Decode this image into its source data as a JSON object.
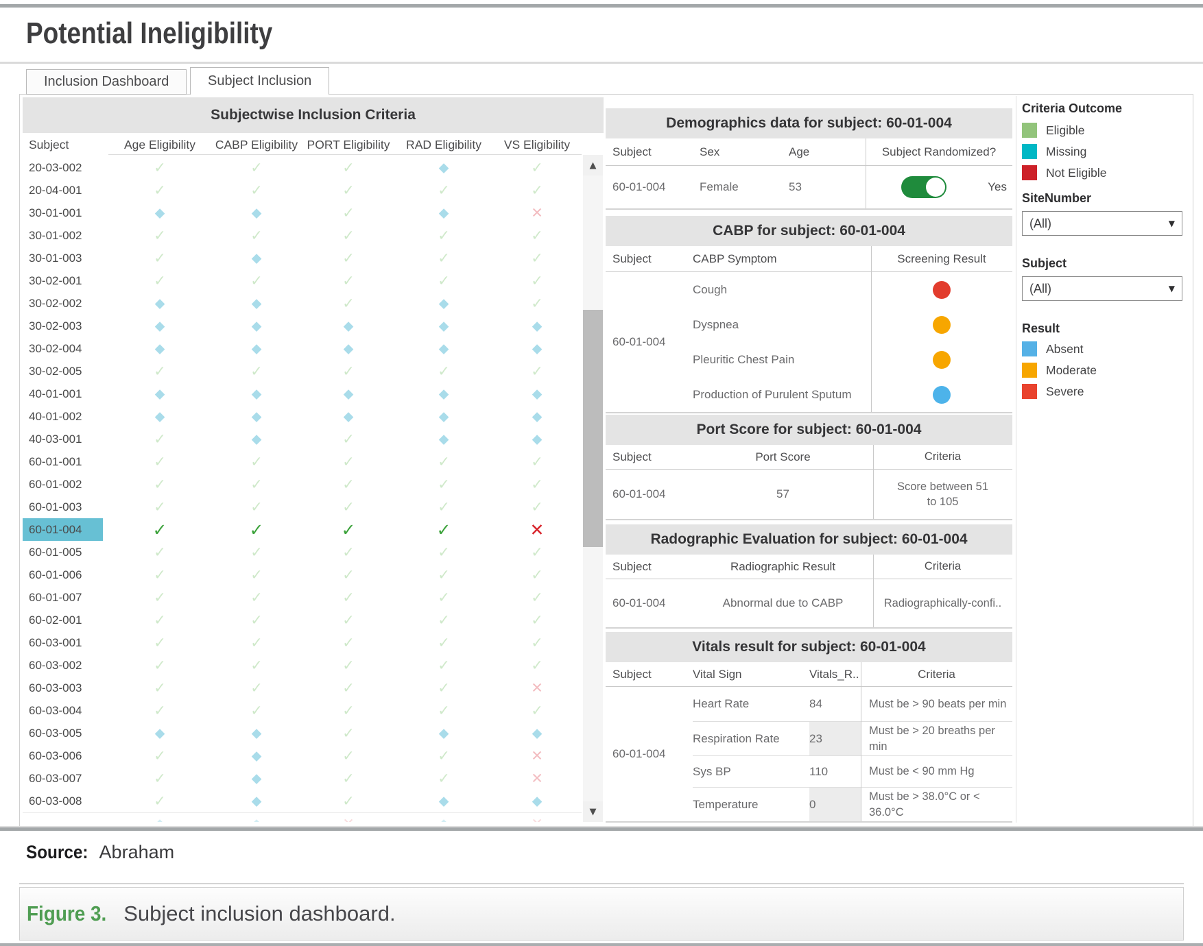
{
  "title": "Potential Ineligibility",
  "tabs": [
    {
      "label": "Inclusion Dashboard",
      "active": false
    },
    {
      "label": "Subject Inclusion",
      "active": true
    }
  ],
  "icons": {
    "scroll_up": "▲",
    "scroll_down": "▼",
    "dropdown_arrow": "▼"
  },
  "inclusion_table": {
    "title": "Subjectwise Inclusion Criteria",
    "columns": [
      "Subject",
      "Age Eligibility",
      "CABP Eligibility",
      "PORT Eligibility",
      "RAD Eligibility",
      "VS Eligibility"
    ],
    "rows": [
      {
        "subject": "20-03-002",
        "selected": false,
        "cells": [
          "eligible",
          "eligible",
          "eligible",
          "missing",
          "eligible"
        ]
      },
      {
        "subject": "20-04-001",
        "selected": false,
        "cells": [
          "eligible",
          "eligible",
          "eligible",
          "eligible",
          "eligible"
        ]
      },
      {
        "subject": "30-01-001",
        "selected": false,
        "cells": [
          "missing",
          "missing",
          "eligible",
          "missing",
          "not_eligible"
        ]
      },
      {
        "subject": "30-01-002",
        "selected": false,
        "cells": [
          "eligible",
          "eligible",
          "eligible",
          "eligible",
          "eligible"
        ]
      },
      {
        "subject": "30-01-003",
        "selected": false,
        "cells": [
          "eligible",
          "missing",
          "eligible",
          "eligible",
          "eligible"
        ]
      },
      {
        "subject": "30-02-001",
        "selected": false,
        "cells": [
          "eligible",
          "eligible",
          "eligible",
          "eligible",
          "eligible"
        ]
      },
      {
        "subject": "30-02-002",
        "selected": false,
        "cells": [
          "missing",
          "missing",
          "eligible",
          "missing",
          "eligible"
        ]
      },
      {
        "subject": "30-02-003",
        "selected": false,
        "cells": [
          "missing",
          "missing",
          "missing",
          "missing",
          "missing"
        ]
      },
      {
        "subject": "30-02-004",
        "selected": false,
        "cells": [
          "missing",
          "missing",
          "missing",
          "missing",
          "missing"
        ]
      },
      {
        "subject": "30-02-005",
        "selected": false,
        "cells": [
          "eligible",
          "eligible",
          "eligible",
          "eligible",
          "eligible"
        ]
      },
      {
        "subject": "40-01-001",
        "selected": false,
        "cells": [
          "missing",
          "missing",
          "missing",
          "missing",
          "missing"
        ]
      },
      {
        "subject": "40-01-002",
        "selected": false,
        "cells": [
          "missing",
          "missing",
          "missing",
          "missing",
          "missing"
        ]
      },
      {
        "subject": "40-03-001",
        "selected": false,
        "cells": [
          "eligible",
          "missing",
          "eligible",
          "missing",
          "missing"
        ]
      },
      {
        "subject": "60-01-001",
        "selected": false,
        "cells": [
          "eligible",
          "eligible",
          "eligible",
          "eligible",
          "eligible"
        ]
      },
      {
        "subject": "60-01-002",
        "selected": false,
        "cells": [
          "eligible",
          "eligible",
          "eligible",
          "eligible",
          "eligible"
        ]
      },
      {
        "subject": "60-01-003",
        "selected": false,
        "cells": [
          "eligible",
          "eligible",
          "eligible",
          "eligible",
          "eligible"
        ]
      },
      {
        "subject": "60-01-004",
        "selected": true,
        "cells": [
          "eligible",
          "eligible",
          "eligible",
          "eligible",
          "not_eligible"
        ]
      },
      {
        "subject": "60-01-005",
        "selected": false,
        "cells": [
          "eligible",
          "eligible",
          "eligible",
          "eligible",
          "eligible"
        ]
      },
      {
        "subject": "60-01-006",
        "selected": false,
        "cells": [
          "eligible",
          "eligible",
          "eligible",
          "eligible",
          "eligible"
        ]
      },
      {
        "subject": "60-01-007",
        "selected": false,
        "cells": [
          "eligible",
          "eligible",
          "eligible",
          "eligible",
          "eligible"
        ]
      },
      {
        "subject": "60-02-001",
        "selected": false,
        "cells": [
          "eligible",
          "eligible",
          "eligible",
          "eligible",
          "eligible"
        ]
      },
      {
        "subject": "60-03-001",
        "selected": false,
        "cells": [
          "eligible",
          "eligible",
          "eligible",
          "eligible",
          "eligible"
        ]
      },
      {
        "subject": "60-03-002",
        "selected": false,
        "cells": [
          "eligible",
          "eligible",
          "eligible",
          "eligible",
          "eligible"
        ]
      },
      {
        "subject": "60-03-003",
        "selected": false,
        "cells": [
          "eligible",
          "eligible",
          "eligible",
          "eligible",
          "not_eligible"
        ]
      },
      {
        "subject": "60-03-004",
        "selected": false,
        "cells": [
          "eligible",
          "eligible",
          "eligible",
          "eligible",
          "eligible"
        ]
      },
      {
        "subject": "60-03-005",
        "selected": false,
        "cells": [
          "missing",
          "missing",
          "eligible",
          "missing",
          "missing"
        ]
      },
      {
        "subject": "60-03-006",
        "selected": false,
        "cells": [
          "eligible",
          "missing",
          "eligible",
          "eligible",
          "not_eligible"
        ]
      },
      {
        "subject": "60-03-007",
        "selected": false,
        "cells": [
          "eligible",
          "missing",
          "eligible",
          "eligible",
          "not_eligible"
        ]
      },
      {
        "subject": "60-03-008",
        "selected": false,
        "cells": [
          "eligible",
          "missing",
          "eligible",
          "missing",
          "missing"
        ]
      }
    ],
    "partial_row": [
      "missing",
      "missing",
      "not_eligible",
      "missing",
      "not_eligible"
    ]
  },
  "panels": {
    "demographics": {
      "title": "Demographics data for subject: 60-01-004",
      "columns": [
        "Subject",
        "Sex",
        "Age",
        "Subject Randomized?"
      ],
      "row": {
        "subject": "60-01-004",
        "sex": "Female",
        "age": "53",
        "randomized": "Yes",
        "toggle_on": true
      }
    },
    "cabp": {
      "title": "CABP for subject: 60-01-004",
      "columns": [
        "Subject",
        "CABP Symptom",
        "Screening Result"
      ],
      "subject": "60-01-004",
      "rows": [
        {
          "symptom": "Cough",
          "result": "severe"
        },
        {
          "symptom": "Dyspnea",
          "result": "moderate"
        },
        {
          "symptom": "Pleuritic Chest Pain",
          "result": "moderate"
        },
        {
          "symptom": "Production of Purulent Sputum",
          "result": "absent"
        }
      ]
    },
    "port": {
      "title": "Port Score for subject: 60-01-004",
      "columns": [
        "Subject",
        "Port Score",
        "Criteria"
      ],
      "row": {
        "subject": "60-01-004",
        "score": "57",
        "criteria": "Score between 51 to 105"
      }
    },
    "radiographic": {
      "title": "Radographic Evaluation for subject: 60-01-004",
      "columns": [
        "Subject",
        "Radiographic Result",
        "Criteria"
      ],
      "row": {
        "subject": "60-01-004",
        "result": "Abnormal due to CABP",
        "criteria": "Radiographically-confi.."
      }
    },
    "vitals": {
      "title": "Vitals result for subject: 60-01-004",
      "columns": [
        "Subject",
        "Vital Sign",
        "Vitals_R..",
        "Criteria"
      ],
      "subject": "60-01-004",
      "rows": [
        {
          "sign": "Heart Rate",
          "value": "84",
          "criteria": "Must be > 90 beats per min",
          "shaded": false
        },
        {
          "sign": "Respiration Rate",
          "value": "23",
          "criteria": "Must be > 20 breaths per min",
          "shaded": true
        },
        {
          "sign": "Sys BP",
          "value": "110",
          "criteria": "Must be < 90 mm Hg",
          "shaded": false
        },
        {
          "sign": "Temperature",
          "value": "0",
          "criteria": "Must be > 38.0°C or < 36.0°C",
          "shaded": true
        }
      ]
    }
  },
  "legend": {
    "criteria_outcome": {
      "title": "Criteria Outcome",
      "items": [
        {
          "label": "Eligible",
          "color": "#92c47b"
        },
        {
          "label": "Missing",
          "color": "#00b8c5"
        },
        {
          "label": "Not Eligible",
          "color": "#cd2129"
        }
      ]
    },
    "site_filter": {
      "label": "SiteNumber",
      "value": "(All)"
    },
    "subject_filter": {
      "label": "Subject",
      "value": "(All)"
    },
    "result": {
      "title": "Result",
      "items": [
        {
          "label": "Absent",
          "color": "#55b1e6"
        },
        {
          "label": "Moderate",
          "color": "#f7a600"
        },
        {
          "label": "Severe",
          "color": "#e9432e"
        }
      ]
    }
  },
  "status_colors": {
    "eligible_faded": "#cfe9ca",
    "missing_faded": "#a9dcea",
    "not_eligible_faded": "#f3bdc1",
    "eligible_strong": "#3da33c",
    "not_eligible_strong": "#d8232b",
    "selected_row_bg": "#67c0d4",
    "severe": "#e23c2d",
    "moderate": "#f7a600",
    "absent": "#4db3ea",
    "toggle_on": "#1f8b3c"
  },
  "source": {
    "label": "Source:",
    "value": "Abraham"
  },
  "figure": {
    "label": "Figure 3.",
    "caption": "Subject inclusion dashboard."
  }
}
